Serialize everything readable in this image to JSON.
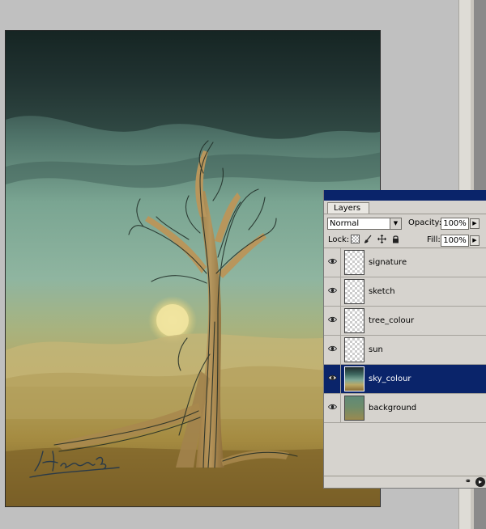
{
  "artwork": {
    "signature_text": "Hatice B."
  },
  "layers_panel": {
    "tab_label": "Layers",
    "blend_mode": "Normal",
    "opacity_label": "Opacity:",
    "opacity_value": "100%",
    "lock_label": "Lock:",
    "fill_label": "Fill:",
    "fill_value": "100%",
    "lock_icons": [
      "lock-transparent-icon",
      "brush-icon",
      "move-icon",
      "padlock-icon"
    ],
    "layers": [
      {
        "name": "signature",
        "visible": true,
        "selected": false,
        "thumb": "transparent"
      },
      {
        "name": "sketch",
        "visible": true,
        "selected": false,
        "thumb": "transparent"
      },
      {
        "name": "tree_colour",
        "visible": true,
        "selected": false,
        "thumb": "transparent"
      },
      {
        "name": "sun",
        "visible": true,
        "selected": false,
        "thumb": "transparent"
      },
      {
        "name": "sky_colour",
        "visible": true,
        "selected": true,
        "thumb": "sky"
      },
      {
        "name": "background",
        "visible": true,
        "selected": false,
        "thumb": "bg"
      }
    ],
    "footer_icons": [
      "link-icon",
      "panel-menu-icon"
    ]
  },
  "colors": {
    "titlebar": "#0a246a",
    "selected_row": "#0a246a",
    "panel_bg": "#d6d3ce",
    "workspace": "#c0c0c0"
  }
}
